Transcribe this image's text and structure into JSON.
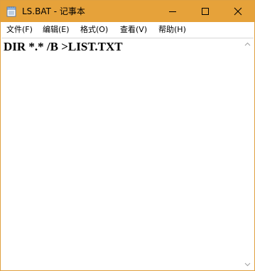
{
  "window": {
    "title": "LS.BAT - 记事本",
    "accent_color": "#e6a23a"
  },
  "controls": {
    "minimize_icon": "minimize-icon",
    "maximize_icon": "maximize-icon",
    "close_icon": "close-icon"
  },
  "menubar": {
    "items": [
      {
        "label": "文件(F)"
      },
      {
        "label": "编辑(E)"
      },
      {
        "label": "格式(O)"
      },
      {
        "label": "查看(V)"
      },
      {
        "label": "帮助(H)"
      }
    ]
  },
  "editor": {
    "content": "DIR *.* /B >LIST.TXT"
  }
}
